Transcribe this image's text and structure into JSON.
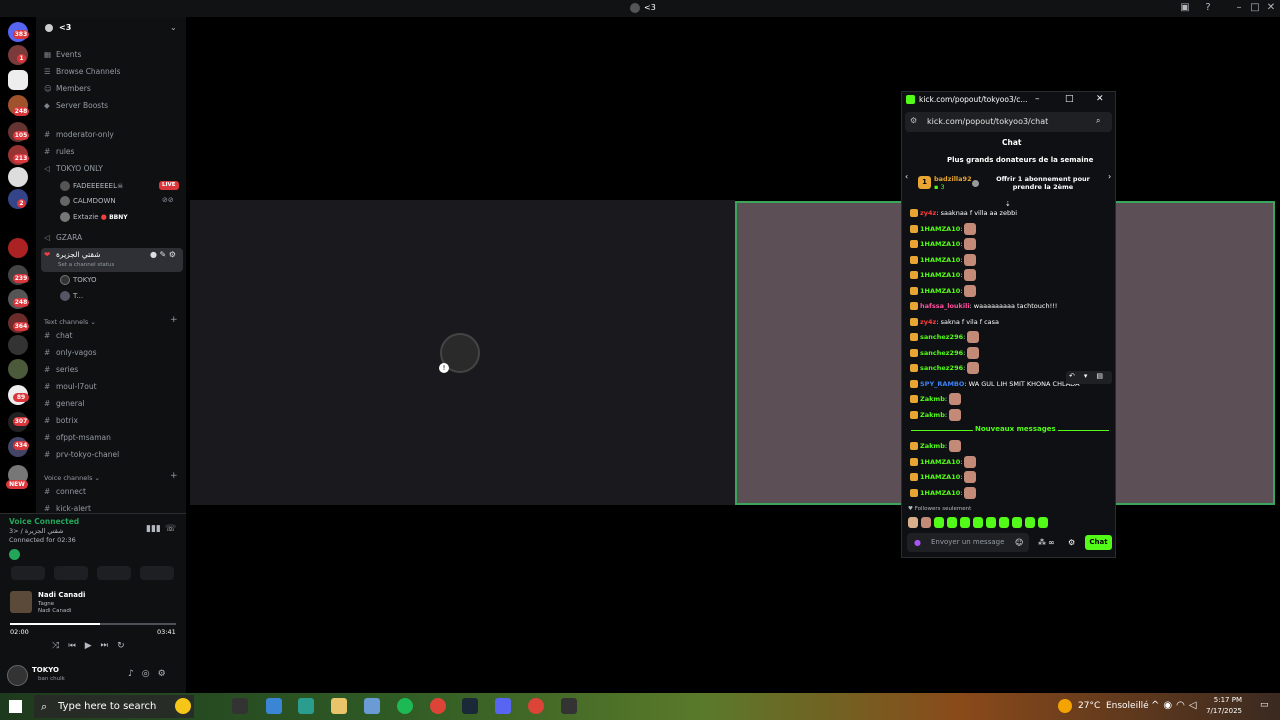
{
  "window": {
    "title": "<3"
  },
  "servers": {
    "badges": [
      "383",
      "1",
      "248",
      "105",
      "213",
      "2",
      "239",
      "248",
      "364",
      "1",
      "89",
      "307",
      "434",
      "NEW"
    ]
  },
  "sidebar": {
    "guild_name": "<3",
    "nav": [
      "Events",
      "Browse Channels",
      "Members",
      "Server Boosts"
    ],
    "channels": [
      "moderator-only",
      "rules",
      "TOKYO ONLY"
    ],
    "tokyo_users": [
      "FADEEEEEEL☠",
      "CALMDOWN",
      "Extazie"
    ],
    "live_label": "LIVE",
    "bbny": "BBNY",
    "gzara": "GZARA",
    "active_voice": "شقتي الجزيرة",
    "status_hint": "Set a channel status",
    "voice_users": [
      "TOKYO",
      "T..."
    ],
    "text_cat": "Text channels",
    "text_channels": [
      "chat",
      "only-vagos",
      "series",
      "moul-l7out",
      "general",
      "botrix",
      "ofppt-msaman",
      "prv-tokyo-chanel"
    ],
    "voice_cat": "Voice channels",
    "voice_channels": [
      "connect",
      "kick-alert"
    ]
  },
  "voice": {
    "status": "Voice Connected",
    "channel": "شقتي الجزيرة / <3",
    "connected_for": "Connected for 02:36"
  },
  "music": {
    "title": "Nadi Canadi",
    "line2": "Tagne",
    "artist": "Nadi Canadi",
    "elapsed": "02:00",
    "total": "03:41",
    "progress": 0.54
  },
  "user": {
    "name": "TOKYO",
    "status": "ban chulk"
  },
  "popup": {
    "title": "kick.com/popout/tokyoo3/c...",
    "url": "kick.com/popout/tokyoo3/chat",
    "chat_header": "Chat",
    "donor_title": "Plus grands donateurs de la semaine",
    "donor_name": "badzilla92",
    "donor_rank": "1",
    "donor_count": "3",
    "offer_text": "Offrir 1 abonnement pour prendre la 2ème",
    "messages": [
      {
        "user": "zy4z",
        "text": ": saaknaa f villa aa zebbi",
        "color": "#ff3b3b",
        "emote": false
      },
      {
        "user": "1HAMZA10",
        "text": ":",
        "color": "#53fc18",
        "emote": true
      },
      {
        "user": "1HAMZA10",
        "text": ":",
        "color": "#53fc18",
        "emote": true
      },
      {
        "user": "1HAMZA10",
        "text": ":",
        "color": "#53fc18",
        "emote": true
      },
      {
        "user": "1HAMZA10",
        "text": ":",
        "color": "#53fc18",
        "emote": true
      },
      {
        "user": "1HAMZA10",
        "text": ":",
        "color": "#53fc18",
        "emote": true
      },
      {
        "user": "hafssa_loukili",
        "text": ": waaaaaaaaa tachtouch!!!",
        "color": "#ff4fa0",
        "emote": false
      },
      {
        "user": "zy4z",
        "text": ": sakna f vila f casa",
        "color": "#ff3b3b",
        "emote": false
      },
      {
        "user": "sanchez296",
        "text": ":",
        "color": "#53fc18",
        "emote": true
      },
      {
        "user": "sanchez296",
        "text": ":",
        "color": "#53fc18",
        "emote": true
      },
      {
        "user": "sanchez296",
        "text": ":",
        "color": "#53fc18",
        "emote": true
      },
      {
        "user": "SPY_RAMBO",
        "text": ": WA GUL LIH SMIT KHONA CHLADA",
        "color": "#3b82f6",
        "emote": false
      },
      {
        "user": "Zakmb",
        "text": ":",
        "color": "#53fc18",
        "emote": true
      },
      {
        "user": "Zakmb",
        "text": ":",
        "color": "#53fc18",
        "emote": true
      }
    ],
    "new_messages": "Nouveaux messages",
    "after": [
      {
        "user": "Zakmb",
        "text": ":",
        "color": "#53fc18",
        "emote": true
      },
      {
        "user": "1HAMZA10",
        "text": ":",
        "color": "#53fc18",
        "emote": true
      },
      {
        "user": "1HAMZA10",
        "text": ":",
        "color": "#53fc18",
        "emote": true
      },
      {
        "user": "1HAMZA10",
        "text": ":",
        "color": "#53fc18",
        "emote": true
      }
    ],
    "followers_only": "Followers seulement",
    "input_placeholder": "Envoyer un message",
    "send_label": "Chat"
  },
  "taskbar": {
    "search": "Type here to search",
    "weather": "27°C  Ensoleillé",
    "time": "5:17 PM",
    "date": "7/17/2025"
  }
}
